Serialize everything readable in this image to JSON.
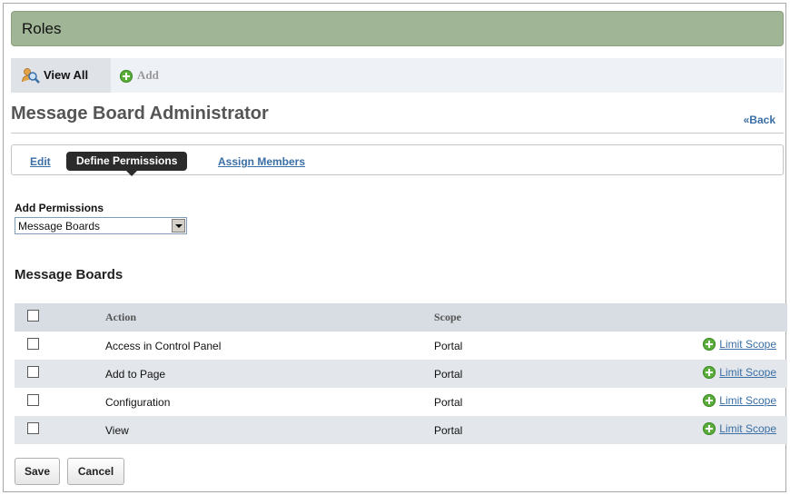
{
  "portlet": {
    "title": "Roles"
  },
  "toolbar": {
    "view_all": "View All",
    "add": "Add"
  },
  "page": {
    "title": "Message Board Administrator",
    "back": "«Back"
  },
  "tabs": [
    {
      "label": "Edit"
    },
    {
      "label": "Define Permissions"
    },
    {
      "label": "Assign Members"
    }
  ],
  "add_permissions": {
    "label": "Add Permissions",
    "selected": "Message Boards"
  },
  "section": {
    "title": "Message Boards"
  },
  "table": {
    "headers": {
      "action": "Action",
      "scope": "Scope"
    },
    "rows": [
      {
        "action": "Access in Control Panel",
        "scope": "Portal",
        "link": "Limit Scope"
      },
      {
        "action": "Add to Page",
        "scope": "Portal",
        "link": "Limit Scope"
      },
      {
        "action": "Configuration",
        "scope": "Portal",
        "link": "Limit Scope"
      },
      {
        "action": "View",
        "scope": "Portal",
        "link": "Limit Scope"
      }
    ]
  },
  "buttons": {
    "save": "Save",
    "cancel": "Cancel"
  },
  "colors": {
    "title_bar": "#9fb595",
    "link": "#3a6ea5",
    "active_tab": "#2b2b2b",
    "table_header": "#d8dde4"
  }
}
